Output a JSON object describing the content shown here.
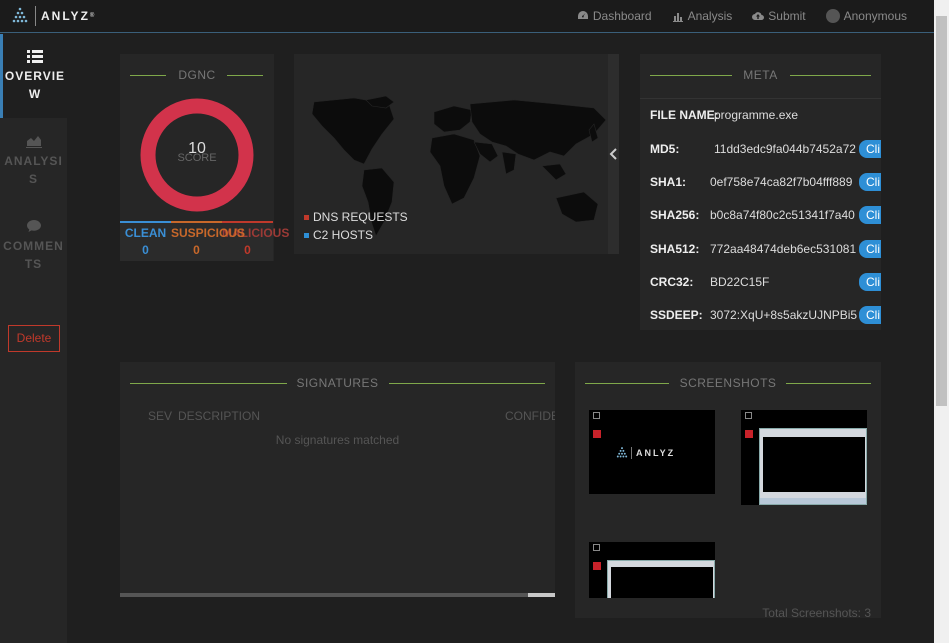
{
  "brand": {
    "name": "ANLYZ",
    "reg": "®"
  },
  "nav": {
    "dashboard": "Dashboard",
    "analysis": "Analysis",
    "submit": "Submit",
    "user": "Anonymous"
  },
  "sidebar": {
    "overview_a": "OVERVIE",
    "overview_b": "W",
    "analysis_a": "ANALYSI",
    "analysis_b": "S",
    "comments_a": "COMMEN",
    "comments_b": "TS",
    "delete": "Delete"
  },
  "dgnc": {
    "title": "DGNC",
    "score": "10",
    "score_label": "SCORE",
    "clean_label": "CLEAN",
    "clean_value": "0",
    "suspicious_label": "SUSPICIOUS",
    "suspicious_value": "0",
    "malicious_label": "MALICIOUS",
    "malicious_value": "0",
    "colors": {
      "ring": "#d2334b",
      "clean": "#3a8fd6",
      "suspicious": "#c9682a",
      "malicious": "#c0392b"
    }
  },
  "map": {
    "legend": [
      {
        "label": "DNS REQUESTS",
        "color": "#c0392b"
      },
      {
        "label": "C2 HOSTS",
        "color": "#2e8fd6"
      }
    ]
  },
  "meta": {
    "title": "META",
    "rows": [
      {
        "key": "FILE NAME:",
        "value": "programme.exe",
        "clip": ""
      },
      {
        "key": "MD5:",
        "value": "11dd3edc9fa044b7452a72",
        "clip": "Cli"
      },
      {
        "key": "SHA1:",
        "value": "0ef758e74ca82f7b04fff889",
        "clip": "Cli"
      },
      {
        "key": "SHA256:",
        "value": "b0c8a74f80c2c51341f7a40",
        "clip": "Cli"
      },
      {
        "key": "SHA512:",
        "value": "772aa48474deb6ec531081",
        "clip": "Cli"
      },
      {
        "key": "CRC32:",
        "value": "BD22C15F",
        "clip": "Cli"
      },
      {
        "key": "SSDEEP:",
        "value": "3072:XqU+8s5akzUJNPBi5",
        "clip": "Cli"
      }
    ]
  },
  "signatures": {
    "title": "SIGNATURES",
    "col_sev": "SEV",
    "col_desc": "DESCRIPTION",
    "col_conf": "CONFIDE",
    "empty": "No signatures matched"
  },
  "screenshots": {
    "title": "SCREENSHOTS",
    "total": "Total Screenshots: 3",
    "thumb_brand": "ANLYZ"
  }
}
